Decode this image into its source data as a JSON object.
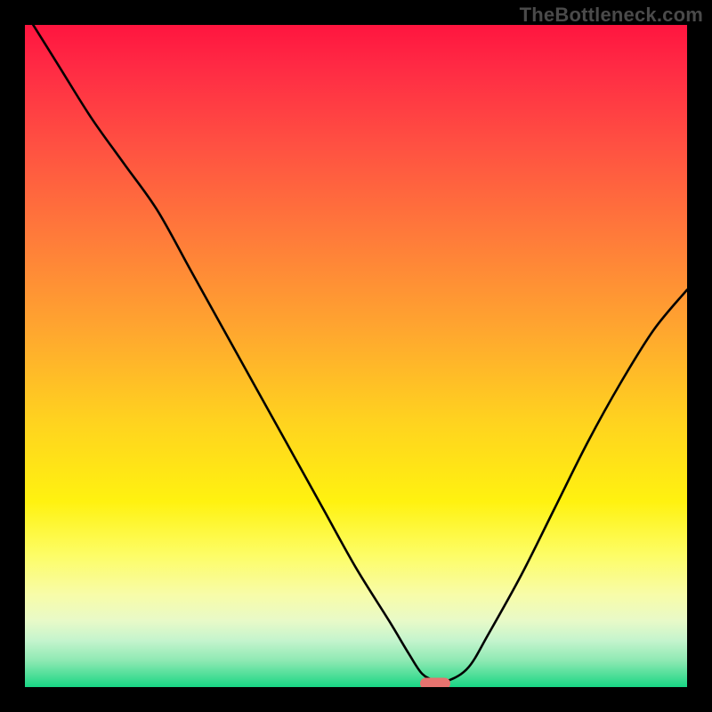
{
  "watermark": "TheBottleneck.com",
  "chart_data": {
    "type": "line",
    "title": "",
    "xlabel": "",
    "ylabel": "",
    "xlim": [
      0,
      100
    ],
    "ylim": [
      0,
      100
    ],
    "grid": false,
    "series": [
      {
        "name": "bottleneck-curve",
        "x": [
          0,
          5,
          10,
          15,
          20,
          25,
          30,
          35,
          40,
          45,
          50,
          55,
          58,
          60,
          62,
          64,
          67,
          70,
          75,
          80,
          85,
          90,
          95,
          100
        ],
        "values": [
          102,
          94,
          86,
          79,
          72,
          63,
          54,
          45,
          36,
          27,
          18,
          10,
          5,
          2,
          1,
          1,
          3,
          8,
          17,
          27,
          37,
          46,
          54,
          60
        ]
      }
    ],
    "marker": {
      "x": 62,
      "y": 0.5
    },
    "background_gradient_stops": [
      {
        "pos": 0,
        "color": "#ff153f"
      },
      {
        "pos": 0.06,
        "color": "#ff2944"
      },
      {
        "pos": 0.18,
        "color": "#ff5042"
      },
      {
        "pos": 0.32,
        "color": "#ff7b3a"
      },
      {
        "pos": 0.46,
        "color": "#ffa62f"
      },
      {
        "pos": 0.6,
        "color": "#ffd31f"
      },
      {
        "pos": 0.72,
        "color": "#fff210"
      },
      {
        "pos": 0.8,
        "color": "#fdfd65"
      },
      {
        "pos": 0.86,
        "color": "#f8fca8"
      },
      {
        "pos": 0.9,
        "color": "#e8fac8"
      },
      {
        "pos": 0.93,
        "color": "#c4f4cd"
      },
      {
        "pos": 0.96,
        "color": "#8ee9b3"
      },
      {
        "pos": 0.985,
        "color": "#46dd95"
      },
      {
        "pos": 1.0,
        "color": "#17d685"
      }
    ]
  }
}
